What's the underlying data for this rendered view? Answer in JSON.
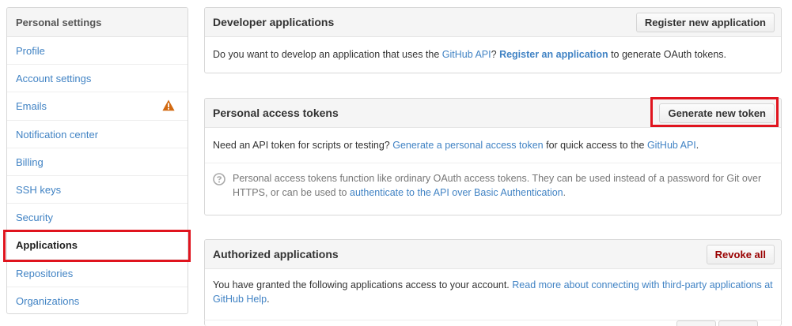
{
  "sidebar": {
    "title": "Personal settings",
    "items": [
      {
        "label": "Profile"
      },
      {
        "label": "Account settings"
      },
      {
        "label": "Emails",
        "badge_icon": "warning-icon"
      },
      {
        "label": "Notification center"
      },
      {
        "label": "Billing"
      },
      {
        "label": "SSH keys"
      },
      {
        "label": "Security"
      },
      {
        "label": "Applications",
        "selected": true
      },
      {
        "label": "Repositories"
      },
      {
        "label": "Organizations"
      }
    ]
  },
  "developer_apps": {
    "title": "Developer applications",
    "button_label": "Register new application",
    "text_before": "Do you want to develop an application that uses the ",
    "api_link": "GitHub API",
    "text_q": "? ",
    "register_link": "Register an application",
    "text_after": " to generate OAuth tokens."
  },
  "access_tokens": {
    "title": "Personal access tokens",
    "button_label": "Generate new token",
    "text_before": "Need an API token for scripts or testing? ",
    "generate_link": "Generate a personal access token",
    "text_mid": " for quick access to the ",
    "api_link": "GitHub API",
    "text_end": ".",
    "note_text": "Personal access tokens function like ordinary OAuth access tokens. They can be used instead of a password for Git over HTTPS, or can be used to ",
    "note_link": "authenticate to the API over Basic Authentication",
    "note_end": "."
  },
  "authorized_apps": {
    "title": "Authorized applications",
    "button_label": "Revoke all",
    "text_before": "You have granted the following applications access to your account. ",
    "help_link": "Read more about connecting with third-party applications at GitHub Help",
    "text_end": "."
  },
  "colors": {
    "link": "#4183c4",
    "highlight": "#e0141e",
    "warning": "#d26911"
  }
}
